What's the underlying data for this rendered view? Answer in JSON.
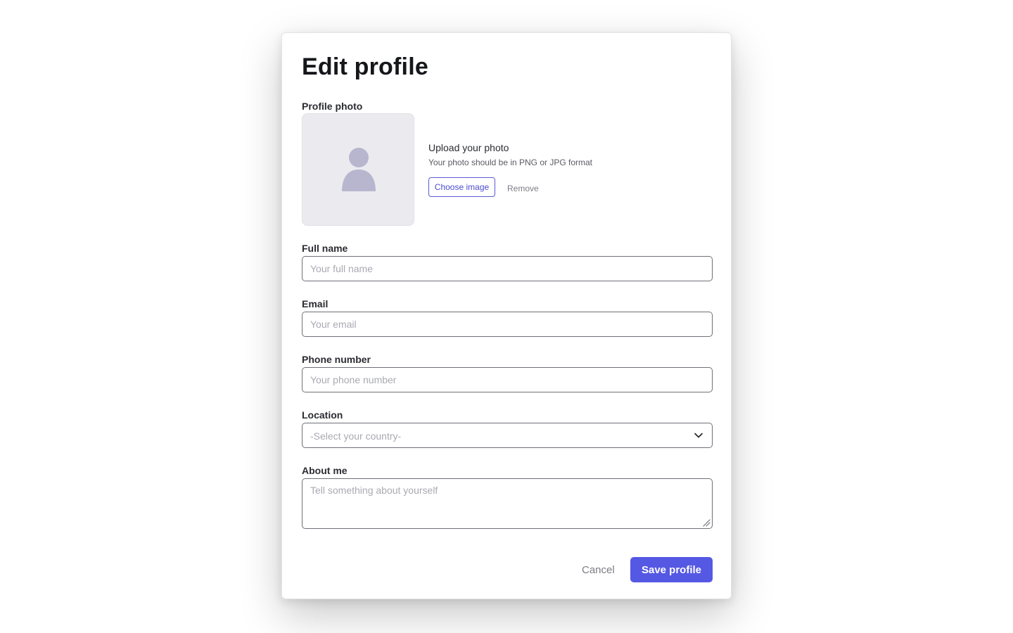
{
  "modal": {
    "title": "Edit profile"
  },
  "photo": {
    "label": "Profile photo",
    "upload_title": "Upload your photo",
    "upload_hint": "Your photo should be in PNG or JPG format",
    "choose_label": "Choose image",
    "remove_label": "Remove",
    "placeholder_icon": "user-silhouette-icon"
  },
  "full_name": {
    "label": "Full name",
    "placeholder": "Your full name",
    "value": ""
  },
  "email": {
    "label": "Email",
    "placeholder": "Your email",
    "value": ""
  },
  "phone": {
    "label": "Phone number",
    "placeholder": "Your phone number",
    "value": ""
  },
  "location": {
    "label": "Location",
    "selected": "-Select your country-",
    "icon": "chevron-down-icon"
  },
  "about": {
    "label": "About me",
    "placeholder": "Tell something about yourself",
    "value": ""
  },
  "actions": {
    "cancel_label": "Cancel",
    "save_label": "Save profile"
  },
  "colors": {
    "accent": "#5558e3",
    "avatar_bg": "#ebebef",
    "avatar_figure": "#b8b6cf"
  }
}
